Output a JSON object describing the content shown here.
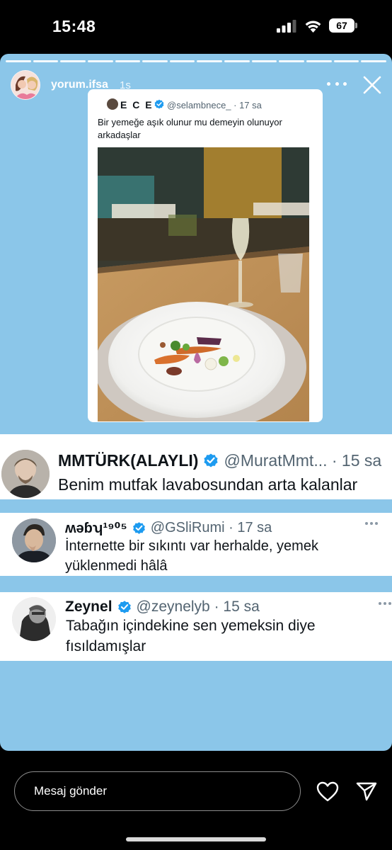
{
  "status_bar": {
    "time": "15:48",
    "battery": "67"
  },
  "story": {
    "background": "#8bc6e9",
    "progress_segments": 14,
    "username": "yorum.ifsa",
    "age": "1s",
    "quote": {
      "name": "E C E",
      "handle": "@selambnece_ · 17 sa",
      "text": "Bir yemeğe aşık olunur mu demeyin olunuyor arkadaşlar"
    },
    "replies": [
      {
        "name": "MMTÜRK(ALAYLI)",
        "handle": "@MuratMmt... · 15 sa",
        "text": "Benim mutfak lavabosundan arta kalanlar"
      },
      {
        "name": "ʍǝɓʮ¹⁹⁰⁵",
        "handle": "@GSliRumi · 17 sa",
        "text": "İnternette bir sıkıntı var herhalde, yemek yüklenmedi hâlâ"
      },
      {
        "name": "Zeynel",
        "handle": "@zeynelyb · 15 sa",
        "text": "Tabağın içindekine sen yemeksin diye fısıldamışlar"
      }
    ]
  },
  "composer": {
    "placeholder": "Mesaj gönder"
  },
  "colors": {
    "verified": "#1d9bf0",
    "handle": "#536471"
  }
}
